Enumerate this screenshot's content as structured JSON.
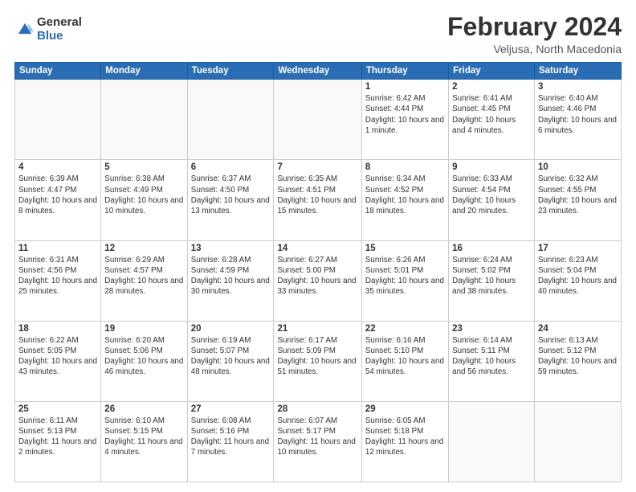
{
  "logo": {
    "general": "General",
    "blue": "Blue"
  },
  "header": {
    "title": "February 2024",
    "subtitle": "Veljusa, North Macedonia"
  },
  "columns": [
    "Sunday",
    "Monday",
    "Tuesday",
    "Wednesday",
    "Thursday",
    "Friday",
    "Saturday"
  ],
  "weeks": [
    [
      {
        "day": "",
        "info": ""
      },
      {
        "day": "",
        "info": ""
      },
      {
        "day": "",
        "info": ""
      },
      {
        "day": "",
        "info": ""
      },
      {
        "day": "1",
        "info": "Sunrise: 6:42 AM\nSunset: 4:44 PM\nDaylight: 10 hours\nand 1 minute."
      },
      {
        "day": "2",
        "info": "Sunrise: 6:41 AM\nSunset: 4:45 PM\nDaylight: 10 hours\nand 4 minutes."
      },
      {
        "day": "3",
        "info": "Sunrise: 6:40 AM\nSunset: 4:46 PM\nDaylight: 10 hours\nand 6 minutes."
      }
    ],
    [
      {
        "day": "4",
        "info": "Sunrise: 6:39 AM\nSunset: 4:47 PM\nDaylight: 10 hours\nand 8 minutes."
      },
      {
        "day": "5",
        "info": "Sunrise: 6:38 AM\nSunset: 4:49 PM\nDaylight: 10 hours\nand 10 minutes."
      },
      {
        "day": "6",
        "info": "Sunrise: 6:37 AM\nSunset: 4:50 PM\nDaylight: 10 hours\nand 13 minutes."
      },
      {
        "day": "7",
        "info": "Sunrise: 6:35 AM\nSunset: 4:51 PM\nDaylight: 10 hours\nand 15 minutes."
      },
      {
        "day": "8",
        "info": "Sunrise: 6:34 AM\nSunset: 4:52 PM\nDaylight: 10 hours\nand 18 minutes."
      },
      {
        "day": "9",
        "info": "Sunrise: 6:33 AM\nSunset: 4:54 PM\nDaylight: 10 hours\nand 20 minutes."
      },
      {
        "day": "10",
        "info": "Sunrise: 6:32 AM\nSunset: 4:55 PM\nDaylight: 10 hours\nand 23 minutes."
      }
    ],
    [
      {
        "day": "11",
        "info": "Sunrise: 6:31 AM\nSunset: 4:56 PM\nDaylight: 10 hours\nand 25 minutes."
      },
      {
        "day": "12",
        "info": "Sunrise: 6:29 AM\nSunset: 4:57 PM\nDaylight: 10 hours\nand 28 minutes."
      },
      {
        "day": "13",
        "info": "Sunrise: 6:28 AM\nSunset: 4:59 PM\nDaylight: 10 hours\nand 30 minutes."
      },
      {
        "day": "14",
        "info": "Sunrise: 6:27 AM\nSunset: 5:00 PM\nDaylight: 10 hours\nand 33 minutes."
      },
      {
        "day": "15",
        "info": "Sunrise: 6:26 AM\nSunset: 5:01 PM\nDaylight: 10 hours\nand 35 minutes."
      },
      {
        "day": "16",
        "info": "Sunrise: 6:24 AM\nSunset: 5:02 PM\nDaylight: 10 hours\nand 38 minutes."
      },
      {
        "day": "17",
        "info": "Sunrise: 6:23 AM\nSunset: 5:04 PM\nDaylight: 10 hours\nand 40 minutes."
      }
    ],
    [
      {
        "day": "18",
        "info": "Sunrise: 6:22 AM\nSunset: 5:05 PM\nDaylight: 10 hours\nand 43 minutes."
      },
      {
        "day": "19",
        "info": "Sunrise: 6:20 AM\nSunset: 5:06 PM\nDaylight: 10 hours\nand 46 minutes."
      },
      {
        "day": "20",
        "info": "Sunrise: 6:19 AM\nSunset: 5:07 PM\nDaylight: 10 hours\nand 48 minutes."
      },
      {
        "day": "21",
        "info": "Sunrise: 6:17 AM\nSunset: 5:09 PM\nDaylight: 10 hours\nand 51 minutes."
      },
      {
        "day": "22",
        "info": "Sunrise: 6:16 AM\nSunset: 5:10 PM\nDaylight: 10 hours\nand 54 minutes."
      },
      {
        "day": "23",
        "info": "Sunrise: 6:14 AM\nSunset: 5:11 PM\nDaylight: 10 hours\nand 56 minutes."
      },
      {
        "day": "24",
        "info": "Sunrise: 6:13 AM\nSunset: 5:12 PM\nDaylight: 10 hours\nand 59 minutes."
      }
    ],
    [
      {
        "day": "25",
        "info": "Sunrise: 6:11 AM\nSunset: 5:13 PM\nDaylight: 11 hours\nand 2 minutes."
      },
      {
        "day": "26",
        "info": "Sunrise: 6:10 AM\nSunset: 5:15 PM\nDaylight: 11 hours\nand 4 minutes."
      },
      {
        "day": "27",
        "info": "Sunrise: 6:08 AM\nSunset: 5:16 PM\nDaylight: 11 hours\nand 7 minutes."
      },
      {
        "day": "28",
        "info": "Sunrise: 6:07 AM\nSunset: 5:17 PM\nDaylight: 11 hours\nand 10 minutes."
      },
      {
        "day": "29",
        "info": "Sunrise: 6:05 AM\nSunset: 5:18 PM\nDaylight: 11 hours\nand 12 minutes."
      },
      {
        "day": "",
        "info": ""
      },
      {
        "day": "",
        "info": ""
      }
    ]
  ]
}
